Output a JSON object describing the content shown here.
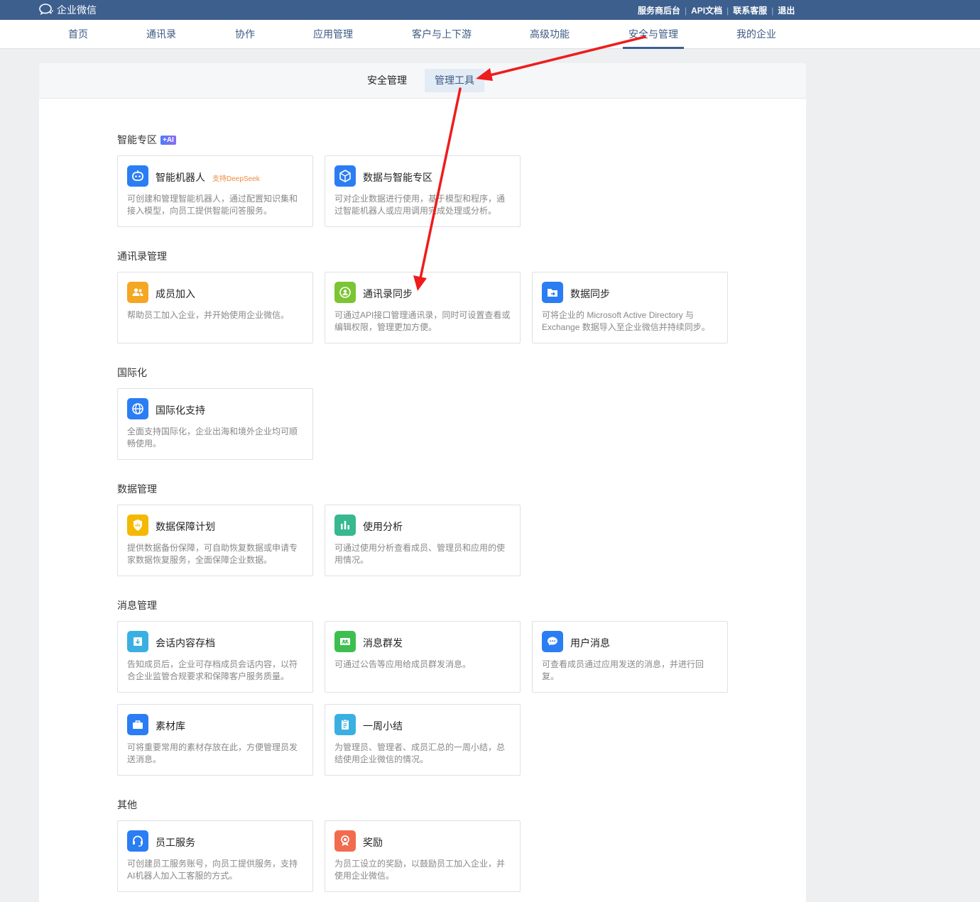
{
  "header": {
    "logo_text": "企业微信",
    "links": [
      "服务商后台",
      "API文档",
      "联系客服",
      "退出"
    ]
  },
  "nav": {
    "items": [
      "首页",
      "通讯录",
      "协作",
      "应用管理",
      "客户与上下游",
      "高级功能",
      "安全与管理",
      "我的企业"
    ],
    "active": "安全与管理"
  },
  "subtabs": {
    "security": "安全管理",
    "tools": "管理工具",
    "active": "管理工具"
  },
  "sections": {
    "ai": {
      "title": "智能专区",
      "badge": "+AI",
      "cards": [
        {
          "title": "智能机器人",
          "tag": "支持DeepSeek",
          "desc": "可创建和管理智能机器人，通过配置知识集和接入模型，向员工提供智能问答服务。",
          "icon": "robot-icon",
          "color": "#2b7df3"
        },
        {
          "title": "数据与智能专区",
          "desc": "可对企业数据进行使用，基于模型和程序，通过智能机器人或应用调用完成处理或分析。",
          "icon": "cube-icon",
          "color": "#2b7df3"
        }
      ]
    },
    "contacts": {
      "title": "通讯录管理",
      "cards": [
        {
          "title": "成员加入",
          "desc": "帮助员工加入企业，并开始使用企业微信。",
          "icon": "members-icon",
          "color": "#f5a623"
        },
        {
          "title": "通讯录同步",
          "desc": "可通过API接口管理通讯录，同时可设置查看或编辑权限，管理更加方便。",
          "icon": "contact-sync-icon",
          "color": "#7bc534"
        },
        {
          "title": "数据同步",
          "desc": "可将企业的 Microsoft Active Directory 与 Exchange 数据导入至企业微信并持续同步。",
          "icon": "folder-sync-icon",
          "color": "#2b7df3"
        }
      ]
    },
    "intl": {
      "title": "国际化",
      "cards": [
        {
          "title": "国际化支持",
          "desc": "全面支持国际化，企业出海和境外企业均可顺畅使用。",
          "icon": "globe-icon",
          "color": "#2b7df3"
        }
      ]
    },
    "data": {
      "title": "数据管理",
      "cards": [
        {
          "title": "数据保障计划",
          "desc": "提供数据备份保障，可自助恢复数据或申请专家数据恢复服务，全面保障企业数据。",
          "icon": "shield-icon",
          "color": "#f5b800"
        },
        {
          "title": "使用分析",
          "desc": "可通过使用分析查看成员、管理员和应用的使用情况。",
          "icon": "bar-chart-icon",
          "color": "#37b88f"
        }
      ]
    },
    "messages": {
      "title": "消息管理",
      "cards": [
        {
          "title": "会话内容存档",
          "desc": "告知成员后，企业可存档成员会话内容，以符合企业监管合规要求和保障客户服务质量。",
          "icon": "archive-icon",
          "color": "#3ab0e2"
        },
        {
          "title": "消息群发",
          "desc": "可通过公告等应用给成员群发消息。",
          "icon": "broadcast-icon",
          "color": "#3cbf4f"
        },
        {
          "title": "用户消息",
          "desc": "可查看成员通过应用发送的消息，并进行回复。",
          "icon": "chat-bubble-icon",
          "color": "#2b7df3"
        },
        {
          "title": "素材库",
          "desc": "可将重要常用的素材存放在此，方便管理员发送消息。",
          "icon": "briefcase-icon",
          "color": "#2b7df3"
        },
        {
          "title": "一周小结",
          "desc": "为管理员、管理者、成员汇总的一周小结，总结使用企业微信的情况。",
          "icon": "clipboard-icon",
          "color": "#3ab0e2"
        }
      ]
    },
    "other": {
      "title": "其他",
      "cards": [
        {
          "title": "员工服务",
          "desc": "可创建员工服务账号，向员工提供服务，支持AI机器人加入工客服的方式。",
          "icon": "headset-icon",
          "color": "#2b7df3"
        },
        {
          "title": "奖励",
          "desc": "为员工设立的奖励，以鼓励员工加入企业，并使用企业微信。",
          "icon": "award-icon",
          "color": "#f26b4f"
        }
      ]
    }
  }
}
